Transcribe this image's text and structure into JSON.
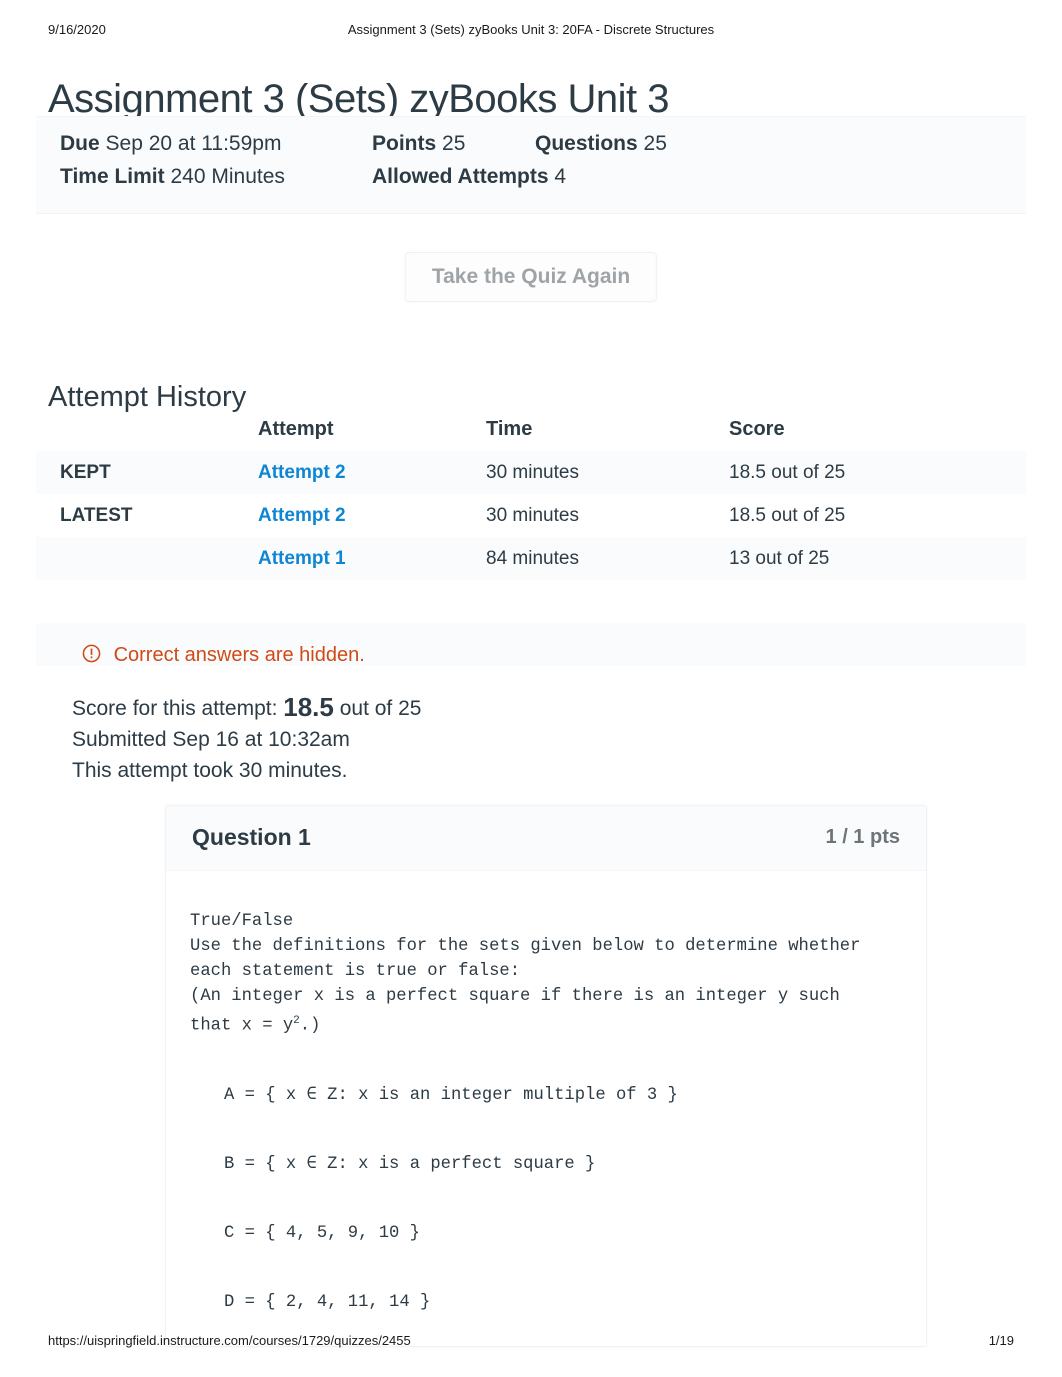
{
  "print_header": {
    "date": "9/16/2020",
    "title": "Assignment 3 (Sets) zyBooks Unit 3: 20FA - Discrete Structures"
  },
  "page_title": "Assignment 3 (Sets) zyBooks Unit 3",
  "quiz_meta": {
    "due_label": "Due",
    "due_value": "Sep 20 at 11:59pm",
    "points_label": "Points",
    "points_value": "25",
    "questions_label": "Questions",
    "questions_value": "25",
    "time_limit_label": "Time Limit",
    "time_limit_value": "240 Minutes",
    "allowed_attempts_label": "Allowed Attempts",
    "allowed_attempts_value": "4"
  },
  "retake_button": {
    "label": "Take the Quiz Again"
  },
  "attempt_history": {
    "section_title": "Attempt History",
    "columns": [
      "",
      "Attempt",
      "Time",
      "Score"
    ],
    "rows": [
      {
        "label": "KEPT",
        "attempt": "Attempt 2",
        "time": "30 minutes",
        "score": "18.5 out of 25"
      },
      {
        "label": "LATEST",
        "attempt": "Attempt 2",
        "time": "30 minutes",
        "score": "18.5 out of 25"
      },
      {
        "label": "",
        "attempt": "Attempt 1",
        "time": "84 minutes",
        "score": "13 out of 25"
      }
    ]
  },
  "warning": {
    "icon": "exclamation-circle-icon",
    "text": "Correct answers are hidden.",
    "color": "#cf4a16"
  },
  "score_summary": {
    "prefix": "Score for this attempt:",
    "score": "18.5",
    "suffix": "out of 25",
    "submitted": "Submitted Sep 16 at 10:32am",
    "duration": "This attempt took 30 minutes."
  },
  "question": {
    "name": "Question 1",
    "points": "1 / 1 pts",
    "type_line": "True/False",
    "prompt_line_1": "Use the definitions for the sets given below to determine whether",
    "prompt_line_2": "each statement is true or false:",
    "prompt_line_3": "(An integer x is a perfect square if there is an integer y such",
    "prompt_line_4_pre": "that x = y",
    "prompt_line_4_sup": "2",
    "prompt_line_4_post": ".)",
    "set_a": "A = { x ∈ Z: x is an integer multiple of 3 }",
    "set_b": "B = { x ∈ Z: x is a perfect square }",
    "set_c": "C = { 4, 5, 9, 10 }",
    "set_d": "D = { 2, 4, 11, 14 }"
  },
  "print_footer": {
    "url": "https://uispringfield.instructure.com/courses/1729/quizzes/2455",
    "page": "1/19"
  },
  "colors": {
    "link_blue": "#0f86d4",
    "warning_orange": "#cf4a16",
    "text": "#2d3b45",
    "muted": "#6d7579",
    "band": "#fafbfc"
  }
}
